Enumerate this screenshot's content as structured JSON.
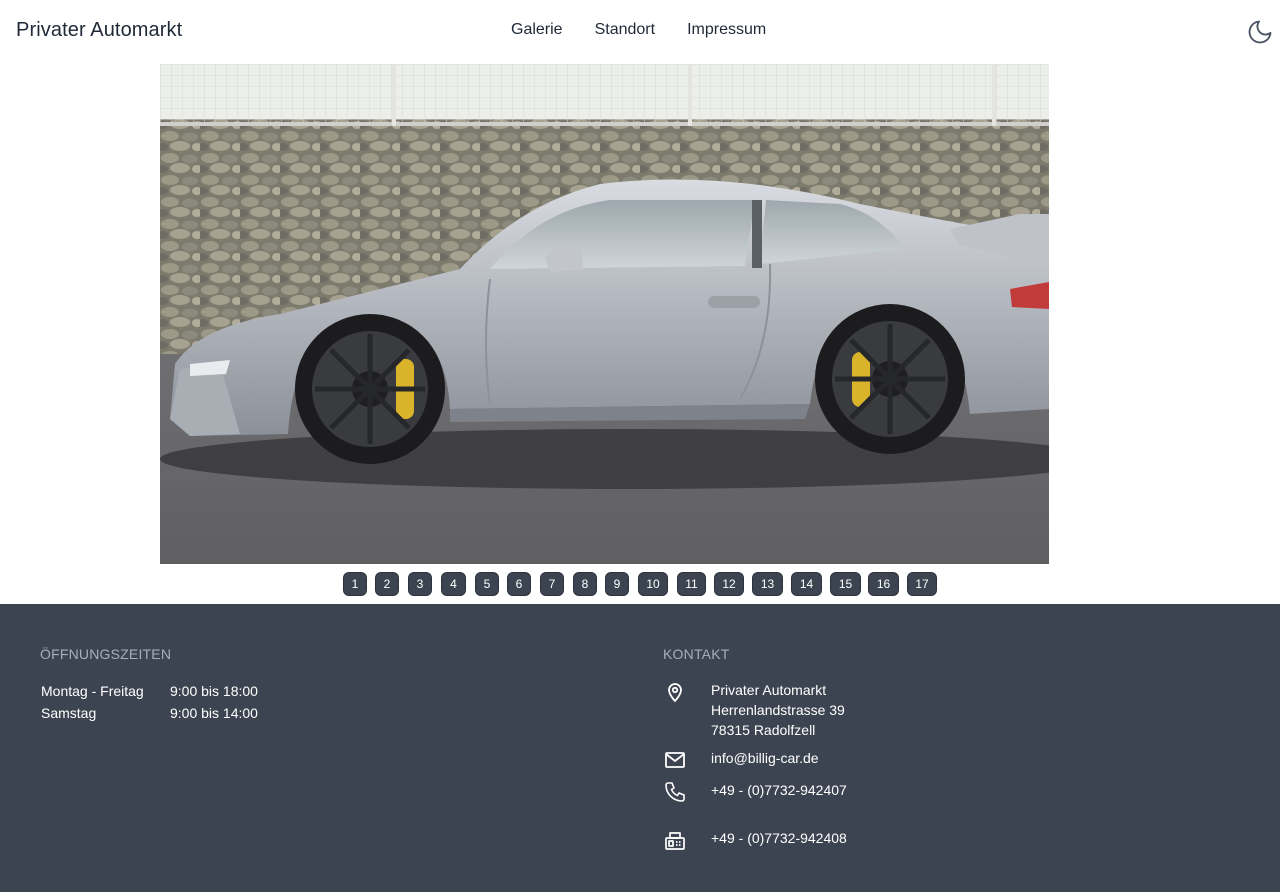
{
  "header": {
    "brand": "Privater Automarkt",
    "nav": [
      "Galerie",
      "Standort",
      "Impressum"
    ],
    "theme_icon": "moon-icon"
  },
  "gallery": {
    "pages": [
      "1",
      "2",
      "3",
      "4",
      "5",
      "6",
      "7",
      "8",
      "9",
      "10",
      "11",
      "12",
      "13",
      "14",
      "15",
      "16",
      "17"
    ]
  },
  "footer": {
    "hours_title": "ÖFFNUNGSZEITEN",
    "hours": [
      {
        "day": "Montag - Freitag",
        "time": "9:00 bis 18:00"
      },
      {
        "day": "Samstag",
        "time": "9:00 bis 14:00"
      }
    ],
    "contact_title": "KONTAKT",
    "address": [
      "Privater Automarkt",
      "Herrenlandstrasse 39",
      "78315 Radolfzell"
    ],
    "email": "info@billig-car.de",
    "phone": "+49 - (0)7732-942407",
    "fax": "+49 - (0)7732-942408",
    "icons": {
      "address": "map-pin-icon",
      "email": "mail-icon",
      "phone": "phone-icon",
      "fax": "fax-icon"
    }
  },
  "colors": {
    "footer_bg": "#3d4451",
    "pager_bg": "#3d4451",
    "muted": "#a6adbb"
  }
}
